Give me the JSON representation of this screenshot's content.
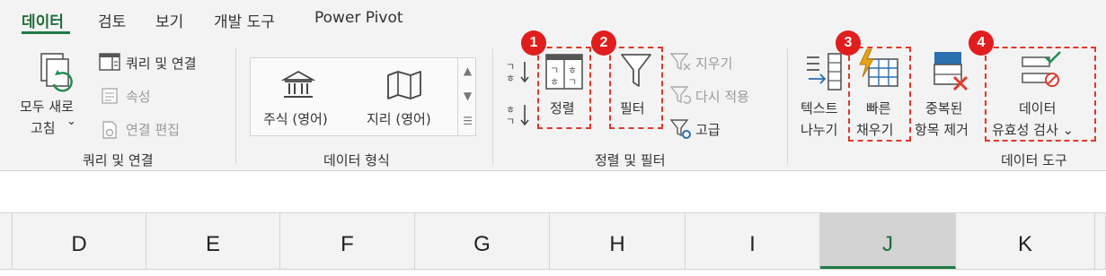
{
  "tabs": [
    {
      "label": "데이터",
      "active": true
    },
    {
      "label": "검토"
    },
    {
      "label": "보기"
    },
    {
      "label": "개발 도구"
    },
    {
      "label": "Power Pivot"
    }
  ],
  "group_queries": {
    "refresh_all_line1": "모두 새로",
    "refresh_all_line2": "고침",
    "refresh_caret": "⌄",
    "queries_connections": "쿼리 및 연결",
    "properties": "속성",
    "edit_links": "연결 편집",
    "label": "쿼리 및 연결"
  },
  "group_data_types": {
    "stocks": "주식 (영어)",
    "geography": "지리 (영어)",
    "label": "데이터 형식"
  },
  "group_sort_filter": {
    "sort": "정렬",
    "filter": "필터",
    "clear": "지우기",
    "reapply": "다시 적용",
    "advanced": "고급",
    "label": "정렬 및 필터"
  },
  "group_data_tools": {
    "text_to_columns_line1": "텍스트",
    "text_to_columns_line2": "나누기",
    "flash_fill_line1": "빠른",
    "flash_fill_line2": "채우기",
    "remove_dup_line1": "중복된",
    "remove_dup_line2": "항목 제거",
    "validation_line1": "데이터",
    "validation_line2": "유효성 검사 ⌄",
    "label": "데이터 도구"
  },
  "badges": [
    "1",
    "2",
    "3",
    "4"
  ],
  "columns": [
    {
      "label": "D"
    },
    {
      "label": "E"
    },
    {
      "label": "F"
    },
    {
      "label": "G"
    },
    {
      "label": "H"
    },
    {
      "label": "I"
    },
    {
      "label": "J",
      "selected": true
    },
    {
      "label": "K"
    }
  ],
  "colors": {
    "accent_green": "#1f7a44",
    "highlight_red": "#e11d1d",
    "icon_orange": "#e8a317"
  }
}
